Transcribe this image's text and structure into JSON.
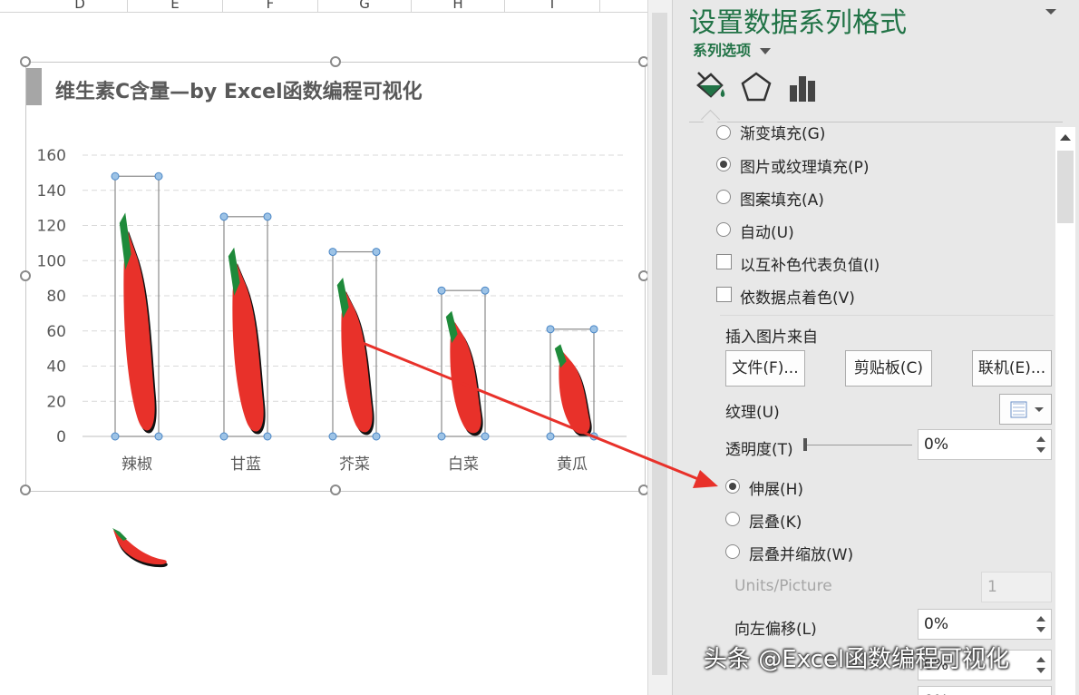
{
  "sheet": {
    "columns": [
      "D",
      "E",
      "F",
      "G",
      "H",
      "I"
    ]
  },
  "chart": {
    "title": "维生素C含量—by Excel函数编程可视化",
    "icon": "chili-pepper-icon",
    "chart_data": {
      "type": "bar",
      "title": "维生素C含量—by Excel函数编程可视化",
      "categories": [
        "辣椒",
        "甘蓝",
        "芥菜",
        "白菜",
        "黄瓜"
      ],
      "values": [
        148,
        125,
        105,
        83,
        61
      ],
      "ylim": [
        0,
        160
      ],
      "yticks": [
        0,
        20,
        40,
        60,
        80,
        100,
        120,
        140,
        160
      ],
      "grid": true,
      "legend": "none",
      "fill": "picture-stretch"
    }
  },
  "pane": {
    "title": "设置数据系列格式",
    "subtitle": "系列选项",
    "tabs": [
      "fill-line-icon",
      "pentagon-effects-icon",
      "bar-chart-series-options-icon"
    ],
    "fill_options": {
      "gradient": "渐变填充(G)",
      "picture": "图片或纹理填充(P)",
      "pattern": "图案填充(A)",
      "auto": "自动(U)"
    },
    "checkboxes": {
      "invert": "以互补色代表负值(I)",
      "vary": "依数据点着色(V)"
    },
    "insert_from": "插入图片来自",
    "buttons": {
      "file": "文件(F)...",
      "clipboard": "剪贴板(C)",
      "online": "联机(E)..."
    },
    "texture_label": "纹理(U)",
    "transparency_label": "透明度(T)",
    "transparency_value": "0%",
    "stack_options": {
      "stretch": "伸展(H)",
      "stack": "层叠(K)",
      "stack_scale": "层叠并缩放(W)"
    },
    "units_label": "Units/Picture",
    "units_value": "1",
    "offset_left_label": "向左偏移(L)",
    "offset_left_value": "0%",
    "offset_bottom_value": "0%",
    "offset_extra_value": "0%"
  },
  "watermark": "头条 @Excel函数编程可视化",
  "colors": {
    "accent": "#217346",
    "pepper": "#e8312a",
    "arrow": "#e8312a"
  }
}
